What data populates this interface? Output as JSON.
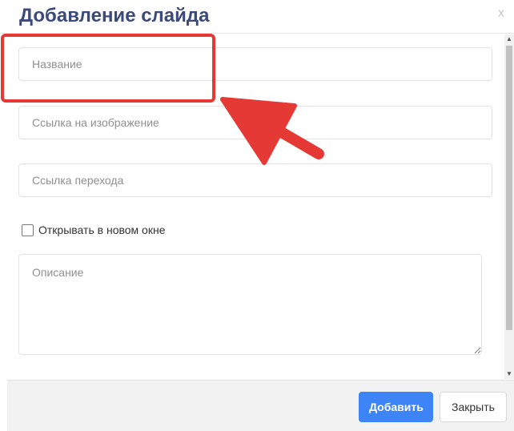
{
  "modal": {
    "title": "Добавление слайда",
    "close_label": "x"
  },
  "form": {
    "name_placeholder": "Название",
    "image_link_placeholder": "Ссылка на изображение",
    "target_link_placeholder": "Ссылка перехода",
    "new_window_label": "Открывать в новом окне",
    "new_window_checked": false,
    "description_placeholder": "Описание"
  },
  "footer": {
    "add_label": "Добавить",
    "close_label": "Закрыть"
  },
  "colors": {
    "title": "#3b4a7a",
    "primary": "#3d84f7",
    "annotation": "#e53935"
  }
}
